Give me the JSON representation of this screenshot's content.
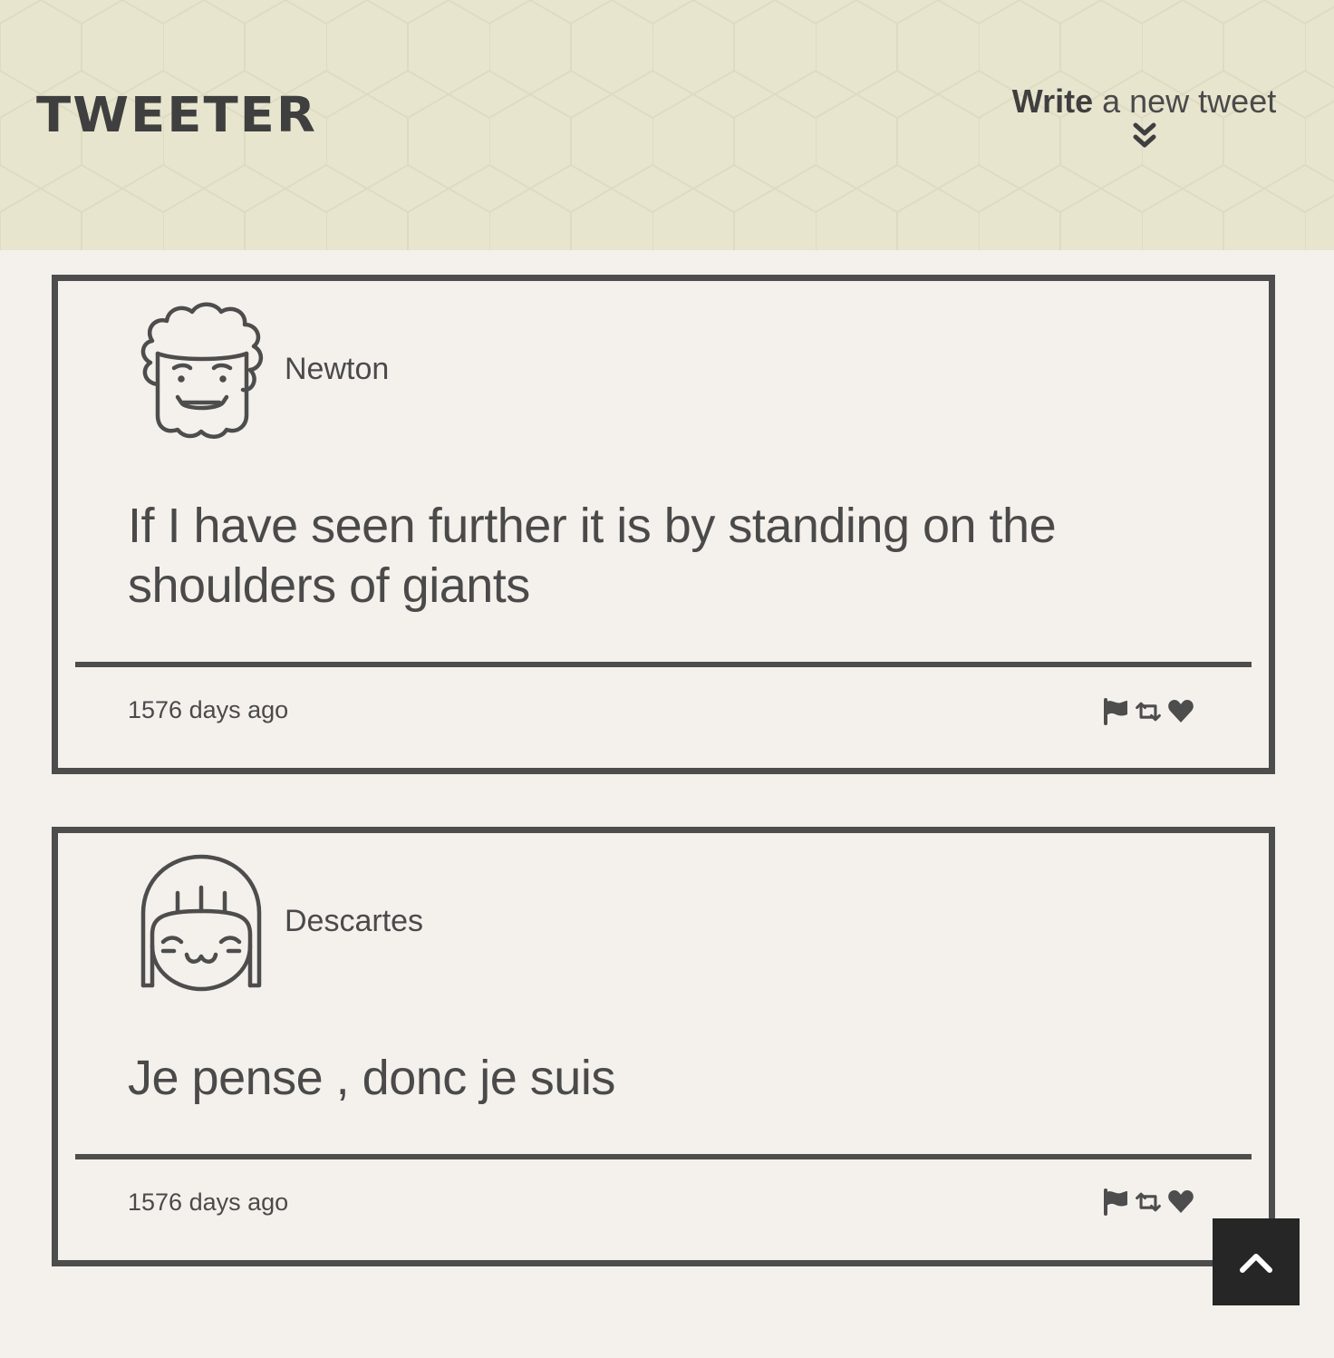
{
  "header": {
    "brand": "TWEETER",
    "compose_strong": "Write",
    "compose_rest": " a new tweet",
    "compose_icon": "double-chevron-down-icon"
  },
  "tweets": [
    {
      "user": "Newton",
      "avatar": "curly-hair-face-avatar",
      "text": "If I have seen further it is by standing on the shoulders of giants",
      "time": "1576 days ago",
      "actions": [
        "flag-icon",
        "retweet-icon",
        "heart-icon"
      ]
    },
    {
      "user": "Descartes",
      "avatar": "bob-hair-face-avatar",
      "text": "Je pense , donc je suis",
      "time": "1576 days ago",
      "actions": [
        "flag-icon",
        "retweet-icon",
        "heart-icon"
      ]
    }
  ],
  "scroll_top": {
    "icon": "chevron-up-icon"
  },
  "colors": {
    "header_bg": "#e8e5cf",
    "page_bg": "#f4f1ec",
    "border": "#4d4d4d",
    "text": "#4a4a4a",
    "scroll_button_bg": "#262626"
  }
}
